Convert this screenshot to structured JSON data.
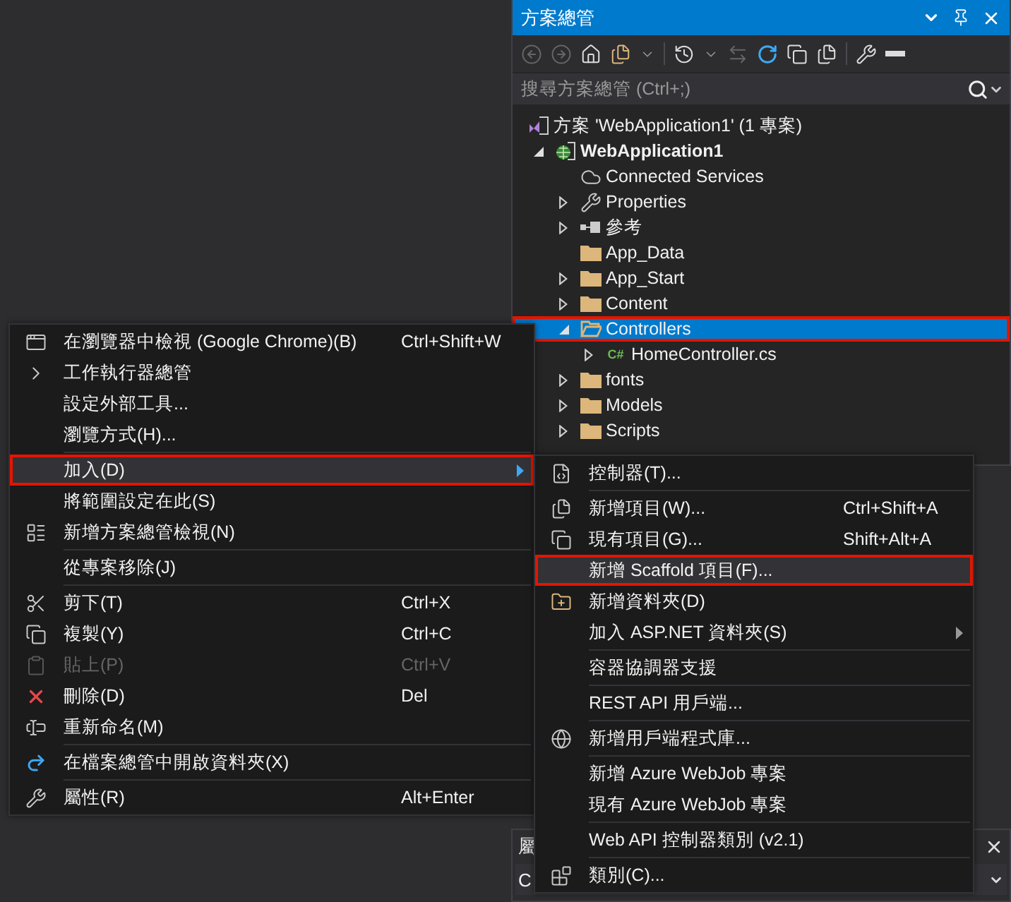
{
  "solution_explorer": {
    "title": "方案總管",
    "search": {
      "placeholder": "搜尋方案總管 (Ctrl+;)"
    },
    "solution": {
      "label": "方案 'WebApplication1' (1 專案)"
    },
    "tree": [
      {
        "label": "WebApplication1",
        "kind": "project",
        "expanded": true,
        "selected": false,
        "annotated": false,
        "children": [
          {
            "label": "Connected Services",
            "kind": "service",
            "selected": false,
            "annotated": false
          },
          {
            "label": "Properties",
            "kind": "properties",
            "expanded": false,
            "selected": false,
            "annotated": false
          },
          {
            "label": "參考",
            "kind": "references",
            "expanded": false,
            "selected": false,
            "annotated": false
          },
          {
            "label": "App_Data",
            "kind": "folder",
            "selected": false,
            "annotated": false
          },
          {
            "label": "App_Start",
            "kind": "folder",
            "expanded": false,
            "selected": false,
            "annotated": false
          },
          {
            "label": "Content",
            "kind": "folder",
            "expanded": false,
            "selected": false,
            "annotated": false
          },
          {
            "label": "Controllers",
            "kind": "folder",
            "expanded": true,
            "selected": true,
            "annotated": true,
            "children": [
              {
                "label": "HomeController.cs",
                "kind": "file",
                "badge": "C#",
                "expanded": false,
                "selected": false,
                "annotated": false
              }
            ]
          },
          {
            "label": "fonts",
            "kind": "folder",
            "expanded": false,
            "selected": false,
            "annotated": false
          },
          {
            "label": "Models",
            "kind": "folder",
            "expanded": false,
            "selected": false,
            "annotated": false
          },
          {
            "label": "Scripts",
            "kind": "folder",
            "expanded": false,
            "selected": false,
            "annotated": false
          }
        ]
      }
    ]
  },
  "context_menu": {
    "items": [
      {
        "kind": "item",
        "label": "在瀏覽器中檢視 (Google Chrome)(B)",
        "shortcut": "Ctrl+Shift+W",
        "selected": false,
        "disabled": false,
        "annotated": false
      },
      {
        "kind": "item",
        "label": "工作執行器總管",
        "selected": false,
        "disabled": false,
        "annotated": false
      },
      {
        "kind": "item",
        "label": "設定外部工具...",
        "selected": false,
        "disabled": false,
        "annotated": false
      },
      {
        "kind": "item",
        "label": "瀏覽方式(H)...",
        "selected": false,
        "disabled": false,
        "annotated": false
      },
      {
        "kind": "separator"
      },
      {
        "kind": "item",
        "label": "加入(D)",
        "submenu": true,
        "selected": true,
        "disabled": false,
        "annotated": true
      },
      {
        "kind": "item",
        "label": "將範圍設定在此(S)",
        "selected": false,
        "disabled": false,
        "annotated": false
      },
      {
        "kind": "item",
        "label": "新增方案總管檢視(N)",
        "selected": false,
        "disabled": false,
        "annotated": false
      },
      {
        "kind": "separator"
      },
      {
        "kind": "item",
        "label": "從專案移除(J)",
        "selected": false,
        "disabled": false,
        "annotated": false
      },
      {
        "kind": "separator"
      },
      {
        "kind": "item",
        "label": "剪下(T)",
        "shortcut": "Ctrl+X",
        "selected": false,
        "disabled": false,
        "annotated": false
      },
      {
        "kind": "item",
        "label": "複製(Y)",
        "shortcut": "Ctrl+C",
        "selected": false,
        "disabled": false,
        "annotated": false
      },
      {
        "kind": "item",
        "label": "貼上(P)",
        "shortcut": "Ctrl+V",
        "selected": false,
        "disabled": true,
        "annotated": false
      },
      {
        "kind": "item",
        "label": "刪除(D)",
        "shortcut": "Del",
        "selected": false,
        "disabled": false,
        "annotated": false
      },
      {
        "kind": "item",
        "label": "重新命名(M)",
        "selected": false,
        "disabled": false,
        "annotated": false
      },
      {
        "kind": "separator"
      },
      {
        "kind": "item",
        "label": "在檔案總管中開啟資料夾(X)",
        "selected": false,
        "disabled": false,
        "annotated": false
      },
      {
        "kind": "separator"
      },
      {
        "kind": "item",
        "label": "屬性(R)",
        "shortcut": "Alt+Enter",
        "selected": false,
        "disabled": false,
        "annotated": false
      }
    ]
  },
  "submenu": {
    "items": [
      {
        "kind": "item",
        "label": "控制器(T)...",
        "selected": false,
        "disabled": false,
        "annotated": false
      },
      {
        "kind": "separator"
      },
      {
        "kind": "item",
        "label": "新增項目(W)...",
        "shortcut": "Ctrl+Shift+A",
        "selected": false,
        "disabled": false,
        "annotated": false
      },
      {
        "kind": "item",
        "label": "現有項目(G)...",
        "shortcut": "Shift+Alt+A",
        "selected": false,
        "disabled": false,
        "annotated": false
      },
      {
        "kind": "item",
        "label": "新增 Scaffold 項目(F)...",
        "selected": true,
        "disabled": false,
        "annotated": true
      },
      {
        "kind": "item",
        "label": "新增資料夾(D)",
        "selected": false,
        "disabled": false,
        "annotated": false
      },
      {
        "kind": "item",
        "label": "加入 ASP.NET 資料夾(S)",
        "submenu": true,
        "selected": false,
        "disabled": false,
        "annotated": false
      },
      {
        "kind": "separator"
      },
      {
        "kind": "item",
        "label": "容器協調器支援",
        "selected": false,
        "disabled": false,
        "annotated": false
      },
      {
        "kind": "separator"
      },
      {
        "kind": "item",
        "label": "REST API 用戶端...",
        "selected": false,
        "disabled": false,
        "annotated": false
      },
      {
        "kind": "separator"
      },
      {
        "kind": "item",
        "label": "新增用戶端程式庫...",
        "selected": false,
        "disabled": false,
        "annotated": false
      },
      {
        "kind": "separator"
      },
      {
        "kind": "item",
        "label": "新增 Azure WebJob 專案",
        "selected": false,
        "disabled": false,
        "annotated": false
      },
      {
        "kind": "item",
        "label": "現有 Azure WebJob 專案",
        "selected": false,
        "disabled": false,
        "annotated": false
      },
      {
        "kind": "separator"
      },
      {
        "kind": "item",
        "label": "Web API 控制器類別 (v2.1)",
        "selected": false,
        "disabled": false,
        "annotated": false
      },
      {
        "kind": "separator"
      },
      {
        "kind": "item",
        "label": "類別(C)...",
        "selected": false,
        "disabled": false,
        "annotated": false
      }
    ]
  },
  "properties_panel": {
    "title": "屬",
    "object": "C"
  }
}
